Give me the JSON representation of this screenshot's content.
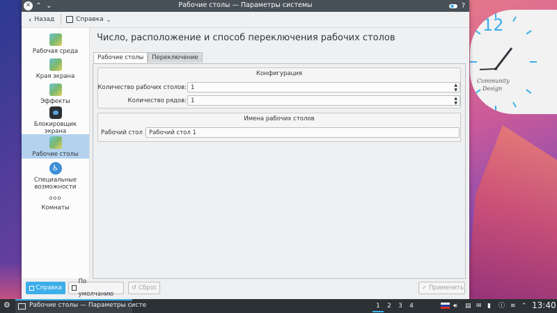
{
  "window": {
    "title": "Рабочие столы — Параметры системы",
    "close_glyph": "✕",
    "up_glyph": "⌃",
    "down_glyph": "⌄",
    "help_glyph": "?"
  },
  "toolbar": {
    "back_label": "Назад",
    "help_label": "Справка"
  },
  "sidebar": {
    "items": [
      {
        "label": "Рабочая среда",
        "icon": "workspace-icon"
      },
      {
        "label": "Края экрана",
        "icon": "screen-edges-icon"
      },
      {
        "label": "Эффекты",
        "icon": "effects-icon"
      },
      {
        "label": "Блокировщик экрана",
        "icon": "lock-screen-icon"
      },
      {
        "label": "Рабочие столы",
        "icon": "virtual-desktops-icon",
        "selected": true
      },
      {
        "label": "Специальные возможности",
        "icon": "accessibility-icon"
      },
      {
        "label": "Комнаты",
        "icon": "activities-icon"
      }
    ],
    "more_glyph": "ooo"
  },
  "main": {
    "title": "Число, расположение и способ переключения рабочих столов",
    "tabs": [
      {
        "label": "Рабочие столы",
        "active": true
      },
      {
        "label": "Переключение",
        "active": false
      }
    ],
    "config_group": {
      "title": "Конфигурация",
      "desktops_label": "Количество рабочих столов:",
      "desktops_value": "1",
      "rows_label": "Количество рядов:",
      "rows_value": "1"
    },
    "names_group": {
      "title": "Имена рабочих столов",
      "desktop1_label": "Рабочий стол 1:",
      "desktop1_value": "Рабочий стол 1"
    }
  },
  "bottom": {
    "help_label": "Справка",
    "defaults_label": "По умолчанию",
    "reset_label": "Сброс",
    "apply_label": "Применить"
  },
  "clock": {
    "hour_label": "12",
    "brand_line1": "Community",
    "brand_line2": "Design"
  },
  "taskbar": {
    "task_title": "Рабочие столы — Параметры систе",
    "pager": [
      "1",
      "2",
      "3",
      "4"
    ],
    "time": "13:40"
  },
  "colors": {
    "accent": "#3daee9",
    "titlebar": "#475057",
    "taskbar": "#2c3136"
  }
}
